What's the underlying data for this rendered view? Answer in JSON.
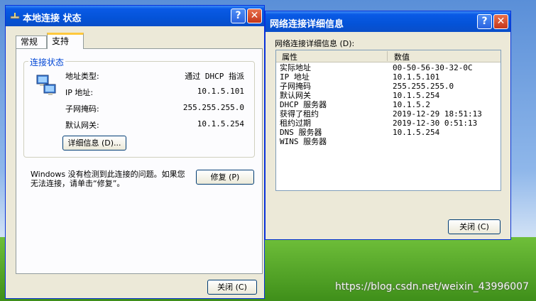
{
  "status_window": {
    "title": "本地连接 状态",
    "tabs": [
      "常规",
      "支持"
    ],
    "active_tab": 1,
    "group_label": "连接状态",
    "rows": [
      {
        "label": "地址类型:",
        "value": "通过 DHCP 指派"
      },
      {
        "label": "IP 地址:",
        "value": "10.1.5.101"
      },
      {
        "label": "子网掩码:",
        "value": "255.255.255.0"
      },
      {
        "label": "默认网关:",
        "value": "10.1.5.254"
      }
    ],
    "details_button": "详细信息 (D)...",
    "message": "Windows 没有检测到此连接的问题。如果您无法连接，请单击“修复”。",
    "repair_button": "修复 (P)",
    "close_button": "关闭 (C)"
  },
  "details_window": {
    "title": "网络连接详细信息",
    "list_label": "网络连接详细信息 (D):",
    "col_property": "属性",
    "col_value": "数值",
    "rows": [
      {
        "property": "实际地址",
        "value": "00-50-56-30-32-0C"
      },
      {
        "property": "IP 地址",
        "value": "10.1.5.101"
      },
      {
        "property": "子网掩码",
        "value": "255.255.255.0"
      },
      {
        "property": "默认网关",
        "value": "10.1.5.254"
      },
      {
        "property": "DHCP 服务器",
        "value": "10.1.5.2"
      },
      {
        "property": "获得了租约",
        "value": "2019-12-29 18:51:13"
      },
      {
        "property": "租约过期",
        "value": "2019-12-30 0:51:13"
      },
      {
        "property": "DNS 服务器",
        "value": "10.1.5.254"
      },
      {
        "property": "WINS 服务器",
        "value": ""
      }
    ],
    "close_button": "关闭 (C)"
  },
  "watermark": "https://blog.csdn.net/weixin_43996007"
}
